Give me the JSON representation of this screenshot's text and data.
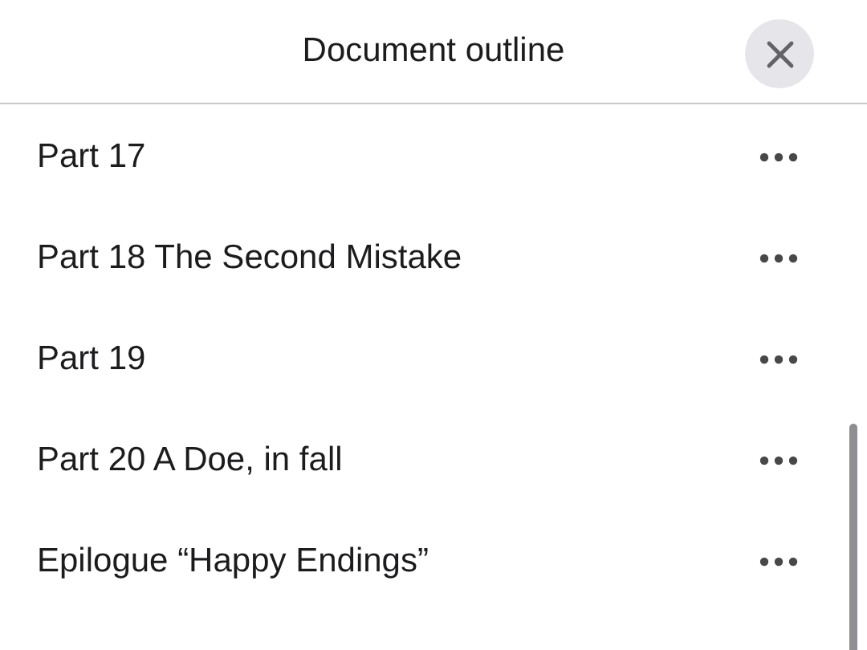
{
  "header": {
    "title": "Document outline"
  },
  "items": [
    {
      "label": "Part 17"
    },
    {
      "label": "Part 18 The Second Mistake"
    },
    {
      "label": "Part 19"
    },
    {
      "label": "Part 20 A Doe, in fall"
    },
    {
      "label": "Epilogue “Happy Endings”"
    }
  ]
}
